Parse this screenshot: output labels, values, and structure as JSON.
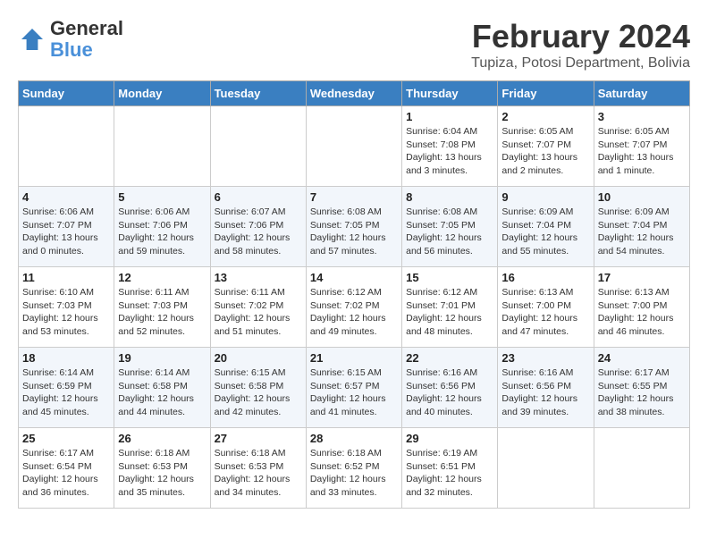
{
  "header": {
    "logo_text_general": "General",
    "logo_text_blue": "Blue",
    "month_title": "February 2024",
    "subtitle": "Tupiza, Potosi Department, Bolivia"
  },
  "days_of_week": [
    "Sunday",
    "Monday",
    "Tuesday",
    "Wednesday",
    "Thursday",
    "Friday",
    "Saturday"
  ],
  "weeks": [
    [
      {
        "day": "",
        "info": ""
      },
      {
        "day": "",
        "info": ""
      },
      {
        "day": "",
        "info": ""
      },
      {
        "day": "",
        "info": ""
      },
      {
        "day": "1",
        "info": "Sunrise: 6:04 AM\nSunset: 7:08 PM\nDaylight: 13 hours\nand 3 minutes."
      },
      {
        "day": "2",
        "info": "Sunrise: 6:05 AM\nSunset: 7:07 PM\nDaylight: 13 hours\nand 2 minutes."
      },
      {
        "day": "3",
        "info": "Sunrise: 6:05 AM\nSunset: 7:07 PM\nDaylight: 13 hours\nand 1 minute."
      }
    ],
    [
      {
        "day": "4",
        "info": "Sunrise: 6:06 AM\nSunset: 7:07 PM\nDaylight: 13 hours\nand 0 minutes."
      },
      {
        "day": "5",
        "info": "Sunrise: 6:06 AM\nSunset: 7:06 PM\nDaylight: 12 hours\nand 59 minutes."
      },
      {
        "day": "6",
        "info": "Sunrise: 6:07 AM\nSunset: 7:06 PM\nDaylight: 12 hours\nand 58 minutes."
      },
      {
        "day": "7",
        "info": "Sunrise: 6:08 AM\nSunset: 7:05 PM\nDaylight: 12 hours\nand 57 minutes."
      },
      {
        "day": "8",
        "info": "Sunrise: 6:08 AM\nSunset: 7:05 PM\nDaylight: 12 hours\nand 56 minutes."
      },
      {
        "day": "9",
        "info": "Sunrise: 6:09 AM\nSunset: 7:04 PM\nDaylight: 12 hours\nand 55 minutes."
      },
      {
        "day": "10",
        "info": "Sunrise: 6:09 AM\nSunset: 7:04 PM\nDaylight: 12 hours\nand 54 minutes."
      }
    ],
    [
      {
        "day": "11",
        "info": "Sunrise: 6:10 AM\nSunset: 7:03 PM\nDaylight: 12 hours\nand 53 minutes."
      },
      {
        "day": "12",
        "info": "Sunrise: 6:11 AM\nSunset: 7:03 PM\nDaylight: 12 hours\nand 52 minutes."
      },
      {
        "day": "13",
        "info": "Sunrise: 6:11 AM\nSunset: 7:02 PM\nDaylight: 12 hours\nand 51 minutes."
      },
      {
        "day": "14",
        "info": "Sunrise: 6:12 AM\nSunset: 7:02 PM\nDaylight: 12 hours\nand 49 minutes."
      },
      {
        "day": "15",
        "info": "Sunrise: 6:12 AM\nSunset: 7:01 PM\nDaylight: 12 hours\nand 48 minutes."
      },
      {
        "day": "16",
        "info": "Sunrise: 6:13 AM\nSunset: 7:00 PM\nDaylight: 12 hours\nand 47 minutes."
      },
      {
        "day": "17",
        "info": "Sunrise: 6:13 AM\nSunset: 7:00 PM\nDaylight: 12 hours\nand 46 minutes."
      }
    ],
    [
      {
        "day": "18",
        "info": "Sunrise: 6:14 AM\nSunset: 6:59 PM\nDaylight: 12 hours\nand 45 minutes."
      },
      {
        "day": "19",
        "info": "Sunrise: 6:14 AM\nSunset: 6:58 PM\nDaylight: 12 hours\nand 44 minutes."
      },
      {
        "day": "20",
        "info": "Sunrise: 6:15 AM\nSunset: 6:58 PM\nDaylight: 12 hours\nand 42 minutes."
      },
      {
        "day": "21",
        "info": "Sunrise: 6:15 AM\nSunset: 6:57 PM\nDaylight: 12 hours\nand 41 minutes."
      },
      {
        "day": "22",
        "info": "Sunrise: 6:16 AM\nSunset: 6:56 PM\nDaylight: 12 hours\nand 40 minutes."
      },
      {
        "day": "23",
        "info": "Sunrise: 6:16 AM\nSunset: 6:56 PM\nDaylight: 12 hours\nand 39 minutes."
      },
      {
        "day": "24",
        "info": "Sunrise: 6:17 AM\nSunset: 6:55 PM\nDaylight: 12 hours\nand 38 minutes."
      }
    ],
    [
      {
        "day": "25",
        "info": "Sunrise: 6:17 AM\nSunset: 6:54 PM\nDaylight: 12 hours\nand 36 minutes."
      },
      {
        "day": "26",
        "info": "Sunrise: 6:18 AM\nSunset: 6:53 PM\nDaylight: 12 hours\nand 35 minutes."
      },
      {
        "day": "27",
        "info": "Sunrise: 6:18 AM\nSunset: 6:53 PM\nDaylight: 12 hours\nand 34 minutes."
      },
      {
        "day": "28",
        "info": "Sunrise: 6:18 AM\nSunset: 6:52 PM\nDaylight: 12 hours\nand 33 minutes."
      },
      {
        "day": "29",
        "info": "Sunrise: 6:19 AM\nSunset: 6:51 PM\nDaylight: 12 hours\nand 32 minutes."
      },
      {
        "day": "",
        "info": ""
      },
      {
        "day": "",
        "info": ""
      }
    ]
  ]
}
